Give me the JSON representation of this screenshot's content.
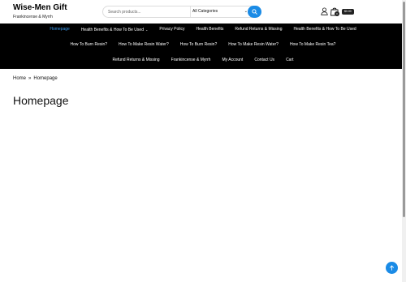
{
  "site": {
    "title": "Wise-Men Gift",
    "tagline": "Frankincense & Myrrh"
  },
  "search": {
    "placeholder": "Search products...",
    "category": "All Categories"
  },
  "cart": {
    "count": "0",
    "total": "$0.00"
  },
  "nav": {
    "row1": [
      {
        "label": "Homepage",
        "active": true
      },
      {
        "label": "Health Benefits & How To Be Used",
        "has_submenu": true
      },
      {
        "label": "Privacy Policy"
      },
      {
        "label": "Health Benefits"
      },
      {
        "label": "Refund Returns & Missing"
      },
      {
        "label": "Health Benefits & How To Be Used"
      }
    ],
    "row2": [
      {
        "label": "How To Burn Resin?"
      },
      {
        "label": "How To Make Resin Water?"
      },
      {
        "label": "How To Burn Resin?"
      },
      {
        "label": "How To Make Resin Water?"
      },
      {
        "label": "How To Make Resin Tea?"
      }
    ],
    "row3": [
      {
        "label": "Refund Returns & Missing"
      },
      {
        "label": "Frankincense & Myrrh"
      },
      {
        "label": "My Account"
      },
      {
        "label": "Contact Us"
      },
      {
        "label": "Cart"
      }
    ]
  },
  "breadcrumb": {
    "home": "Home",
    "separator": "»",
    "current": "Homepage"
  },
  "page": {
    "title": "Homepage"
  },
  "colors": {
    "accent": "#1a8be6",
    "nav_bg": "#000000",
    "active_link": "#3b9cf0"
  }
}
